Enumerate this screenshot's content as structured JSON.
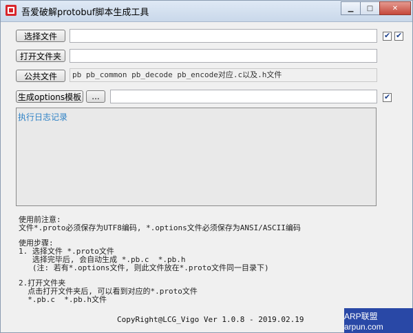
{
  "window": {
    "title": "吾爱破解protobuf脚本生成工具"
  },
  "controls": {
    "select_file": "选择文件",
    "open_folder": "打开文件夹",
    "common_file": "公共文件",
    "common_file_text": "pb  pb_common  pb_decode  pb_encode对应.c以及.h文件",
    "gen_options": "生成options模板",
    "browse": "..."
  },
  "log": {
    "title": "执行日志记录"
  },
  "notes": {
    "line1": "使用前注意:",
    "line2": "文件*.proto必须保存为UTF8编码, *.options文件必须保存为ANSI/ASCII编码",
    "line3": "使用步骤:",
    "line4": "1. 选择文件 *.proto文件",
    "line5": "   选择完毕后, 会自动生成 *.pb.c  *.pb.h",
    "line6": "   (注: 若有*.options文件, 则此文件放在*.proto文件同一目录下)",
    "line7": "2.打开文件夹",
    "line8": "  点击打开文件夹后, 可以看到对应的*.proto文件",
    "line9": "  *.pb.c  *.pb.h文件"
  },
  "footer": "CopyRight@LCG_Vigo  Ver 1.0.8 - 2019.02.19",
  "watermark": "ARP联盟 arpun.com"
}
